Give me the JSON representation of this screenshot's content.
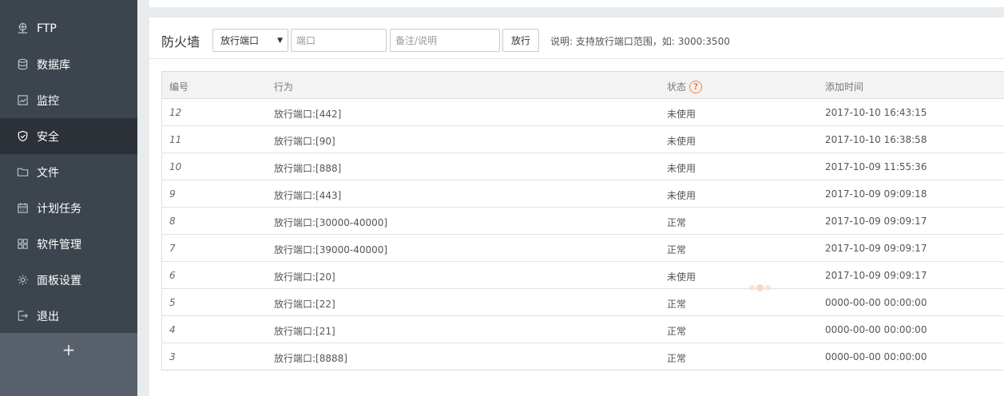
{
  "sidebar": {
    "items": [
      {
        "label": "FTP",
        "icon": "ftp-icon"
      },
      {
        "label": "数据库",
        "icon": "database-icon"
      },
      {
        "label": "监控",
        "icon": "monitor-icon"
      },
      {
        "label": "安全",
        "icon": "shield-icon",
        "active": true
      },
      {
        "label": "文件",
        "icon": "folder-icon"
      },
      {
        "label": "计划任务",
        "icon": "calendar-icon"
      },
      {
        "label": "软件管理",
        "icon": "grid-icon"
      },
      {
        "label": "面板设置",
        "icon": "gear-icon"
      },
      {
        "label": "退出",
        "icon": "logout-icon"
      }
    ],
    "add_label": "+"
  },
  "toolbar": {
    "title": "防火墙",
    "select_value": "放行端口",
    "port_placeholder": "端口",
    "note_placeholder": "备注/说明",
    "allow_label": "放行",
    "hint": "说明: 支持放行端口范围，如: 3000:3500"
  },
  "table": {
    "headers": {
      "id": "编号",
      "action": "行为",
      "status": "状态",
      "time": "添加时间"
    },
    "help_symbol": "?",
    "rows": [
      {
        "id": "12",
        "action": "放行端口:[442]",
        "status": "未使用",
        "time": "2017-10-10 16:43:15"
      },
      {
        "id": "11",
        "action": "放行端口:[90]",
        "status": "未使用",
        "time": "2017-10-10 16:38:58"
      },
      {
        "id": "10",
        "action": "放行端口:[888]",
        "status": "未使用",
        "time": "2017-10-09 11:55:36"
      },
      {
        "id": "9",
        "action": "放行端口:[443]",
        "status": "未使用",
        "time": "2017-10-09 09:09:18"
      },
      {
        "id": "8",
        "action": "放行端口:[30000-40000]",
        "status": "正常",
        "time": "2017-10-09 09:09:17"
      },
      {
        "id": "7",
        "action": "放行端口:[39000-40000]",
        "status": "正常",
        "time": "2017-10-09 09:09:17"
      },
      {
        "id": "6",
        "action": "放行端口:[20]",
        "status": "未使用",
        "time": "2017-10-09 09:09:17"
      },
      {
        "id": "5",
        "action": "放行端口:[22]",
        "status": "正常",
        "time": "0000-00-00 00:00:00"
      },
      {
        "id": "4",
        "action": "放行端口:[21]",
        "status": "正常",
        "time": "0000-00-00 00:00:00"
      },
      {
        "id": "3",
        "action": "放行端口:[8888]",
        "status": "正常",
        "time": "0000-00-00 00:00:00"
      }
    ]
  },
  "colors": {
    "sidebar_bg": "#3c444d",
    "sidebar_active": "#2c3138",
    "accent_help": "#f0883a"
  }
}
